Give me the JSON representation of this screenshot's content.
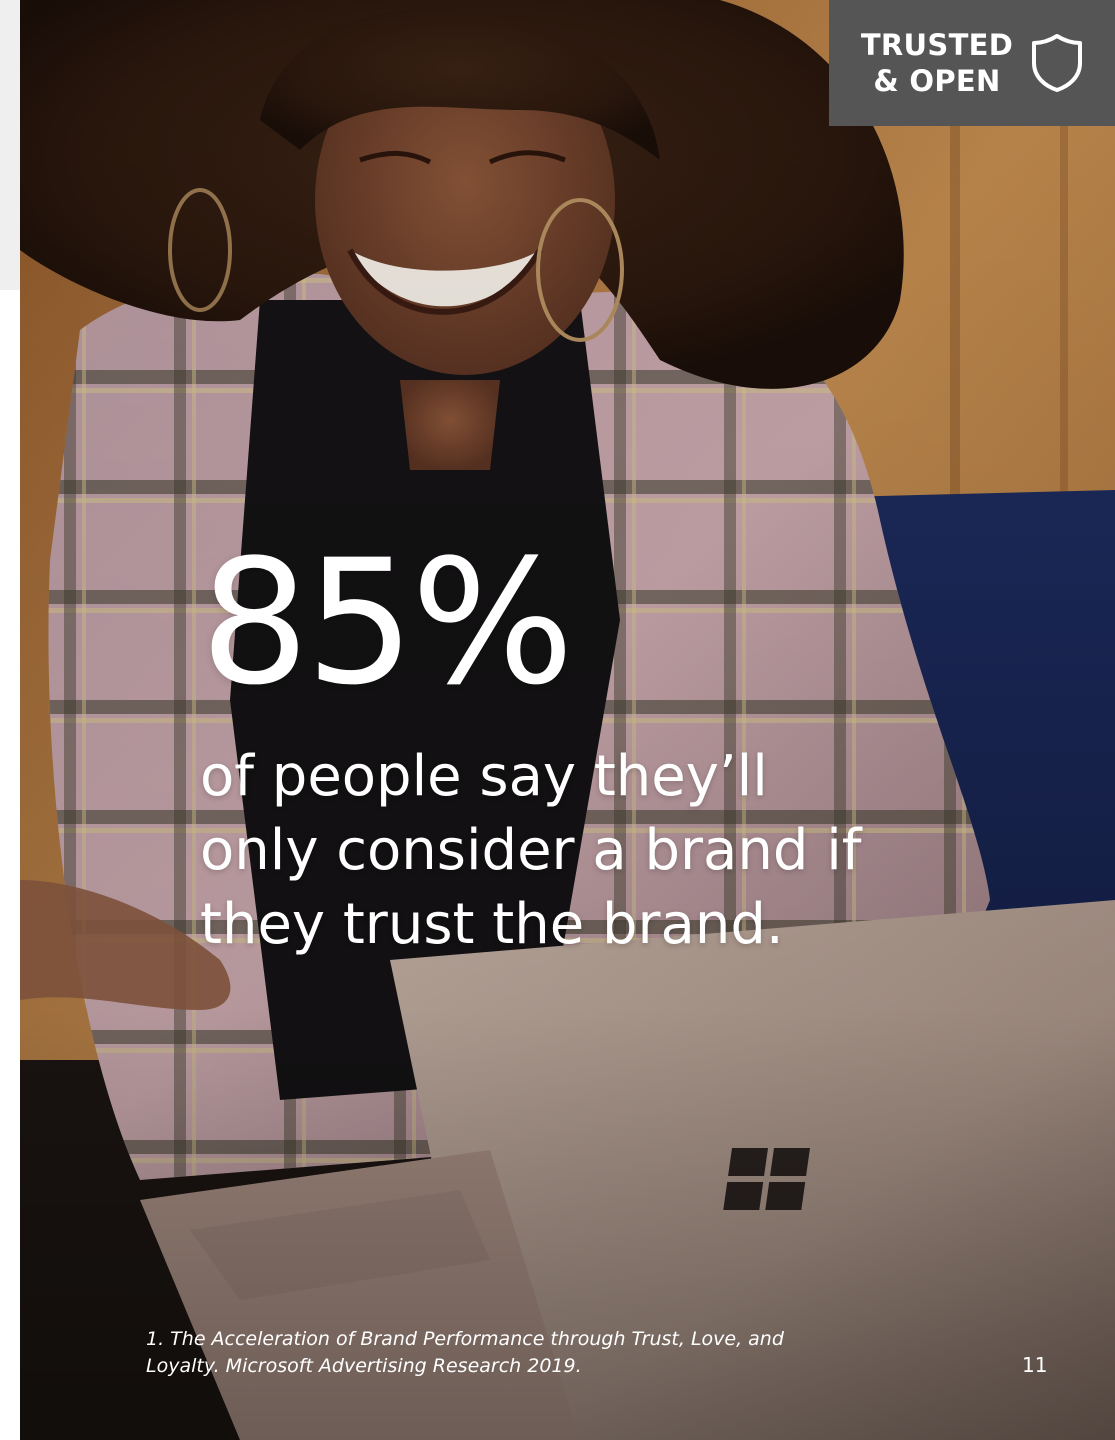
{
  "badge": {
    "line1": "TRUSTED",
    "line2": "& OPEN",
    "icon": "shield-icon",
    "background": "#555556"
  },
  "stat": {
    "number": "85%",
    "line1": "of people say they’ll",
    "line2": "only consider a brand if",
    "line3": "they trust the brand."
  },
  "footnote": {
    "line1": "1. The Acceleration of Brand Performance through Trust, Love, and",
    "line2": "Loyalty. Microsoft Advertising Research 2019."
  },
  "page_number": "11",
  "colors": {
    "text": "#ffffff",
    "laptop": "#b39f93",
    "background_wall": "#b57c3f"
  }
}
